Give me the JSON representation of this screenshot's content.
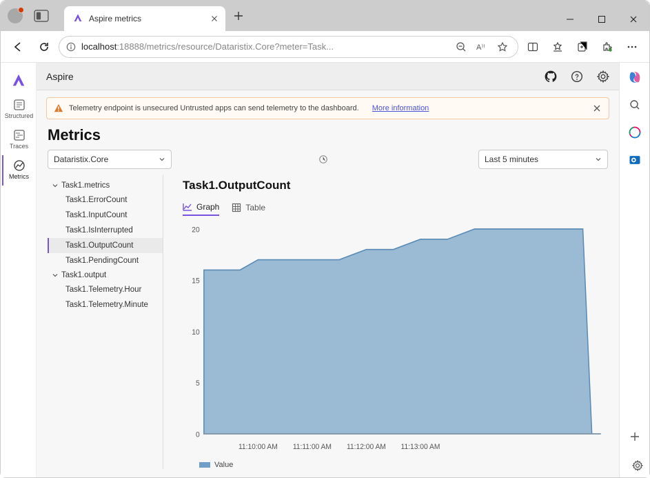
{
  "browser": {
    "tab_title": "Aspire metrics",
    "url_host": "localhost",
    "url_rest": ":18888/metrics/resource/Dataristix.Core?meter=Task..."
  },
  "app_header": {
    "brand": "Aspire"
  },
  "nav": {
    "structured": "Structured",
    "traces": "Traces",
    "metrics": "Metrics"
  },
  "alert": {
    "text": "Telemetry endpoint is unsecured Untrusted apps can send telemetry to the dashboard.",
    "link": "More information"
  },
  "page": {
    "title": "Metrics"
  },
  "resource_dropdown": {
    "value": "Dataristix.Core"
  },
  "range_dropdown": {
    "value": "Last 5 minutes"
  },
  "tree": {
    "group_metrics": "Task1.metrics",
    "leaves_metrics": [
      "Task1.ErrorCount",
      "Task1.InputCount",
      "Task1.IsInterrupted",
      "Task1.OutputCount",
      "Task1.PendingCount"
    ],
    "group_output": "Task1.output",
    "leaves_output": [
      "Task1.Telemetry.Hour",
      "Task1.Telemetry.Minute"
    ]
  },
  "metric": {
    "title": "Task1.OutputCount"
  },
  "viewtabs": {
    "graph": "Graph",
    "table": "Table"
  },
  "legend": {
    "label": "Value"
  },
  "chart_data": {
    "type": "area",
    "title": "Task1.OutputCount",
    "xlabel": "",
    "ylabel": "",
    "ylim": [
      0,
      20
    ],
    "x_ticks": [
      "11:10:00 AM",
      "11:11:00 AM",
      "11:12:00 AM",
      "11:13:00 AM"
    ],
    "series": [
      {
        "name": "Value",
        "x": [
          0,
          40,
          60,
          90,
          150,
          180,
          210,
          240,
          270,
          300,
          420,
          430,
          440
        ],
        "values": [
          16,
          16,
          17,
          17,
          17,
          18,
          18,
          19,
          19,
          20,
          20,
          0,
          0
        ]
      }
    ]
  }
}
